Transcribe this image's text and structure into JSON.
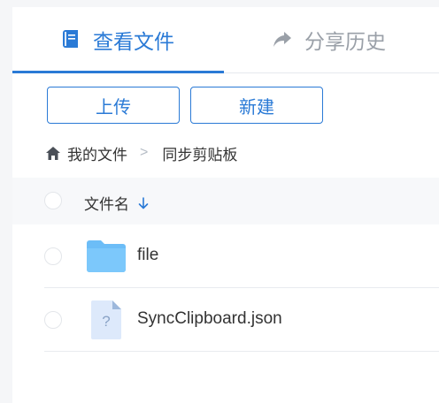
{
  "tabs": {
    "view_label": "查看文件",
    "share_label": "分享历史",
    "active": "view"
  },
  "toolbar": {
    "upload_label": "上传",
    "new_label": "新建"
  },
  "breadcrumb": {
    "home_icon": "home-icon",
    "items": [
      "我的文件",
      "同步剪贴板"
    ],
    "separator": ">"
  },
  "table": {
    "header": {
      "name_label": "文件名",
      "sort_icon": "arrow-down-icon"
    },
    "rows": [
      {
        "name": "file",
        "type": "folder",
        "icon": "folder-icon"
      },
      {
        "name": "SyncClipboard.json",
        "type": "file",
        "icon": "unknown-file-icon"
      }
    ]
  },
  "colors": {
    "accent": "#2a7ad6",
    "tab_inactive": "#9aa0a8",
    "header_bg": "#f7f8fa",
    "folder": "#6cbdf7",
    "file_bg": "#dde9fb"
  }
}
